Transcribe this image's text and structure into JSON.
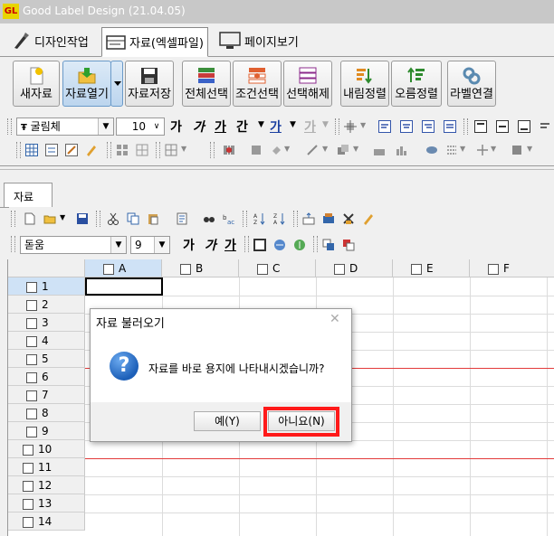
{
  "window": {
    "logo": "GL",
    "title": "Good Label Design (21.04.05)"
  },
  "main_tabs": [
    {
      "label": "디자인작업",
      "icon": "brush-icon"
    },
    {
      "label": "자료(엑셀파일)",
      "icon": "data-card-icon"
    },
    {
      "label": "페이지보기",
      "icon": "monitor-icon"
    }
  ],
  "ribbon": {
    "buttons": [
      {
        "label": "새자료",
        "icon": "new-document-icon"
      },
      {
        "label": "자료열기",
        "icon": "open-folder-icon"
      },
      {
        "label": "자료저장",
        "icon": "save-disk-icon"
      },
      {
        "label": "전체선택",
        "icon": "select-all-icon"
      },
      {
        "label": "조건선택",
        "icon": "select-condition-icon"
      },
      {
        "label": "선택해제",
        "icon": "deselect-icon"
      },
      {
        "label": "내림정렬",
        "icon": "sort-descending-icon"
      },
      {
        "label": "오름정렬",
        "icon": "sort-ascending-icon"
      },
      {
        "label": "라벨연결",
        "icon": "link-icon"
      }
    ]
  },
  "format_toolbar": {
    "font_name": "굴림체",
    "font_size": "10",
    "style_glyphs": [
      "가",
      "가",
      "가",
      "간"
    ],
    "color_glyphs": [
      "가",
      "가"
    ]
  },
  "data_panel": {
    "tab_label": "자료",
    "font_name": "돋움",
    "font_size": "9",
    "style_glyphs": [
      "가",
      "가",
      "가"
    ]
  },
  "grid": {
    "columns": [
      "A",
      "B",
      "C",
      "D",
      "E",
      "F"
    ],
    "rows": [
      "1",
      "2",
      "3",
      "4",
      "5",
      "6",
      "7",
      "8",
      "9",
      "10",
      "11",
      "12",
      "13",
      "14"
    ],
    "selected_cell": "A1"
  },
  "dialog": {
    "title": "자료 불러오기",
    "message": "자료를 바로 용지에 나타내시겠습니까?",
    "yes_label": "예(Y)",
    "no_label": "아니요(N)",
    "icon": "question-icon",
    "highlight_color": "#ff1a1a"
  },
  "colors": {
    "accent_red": "#e23a3a",
    "selection_blue": "#cfe2f6"
  }
}
